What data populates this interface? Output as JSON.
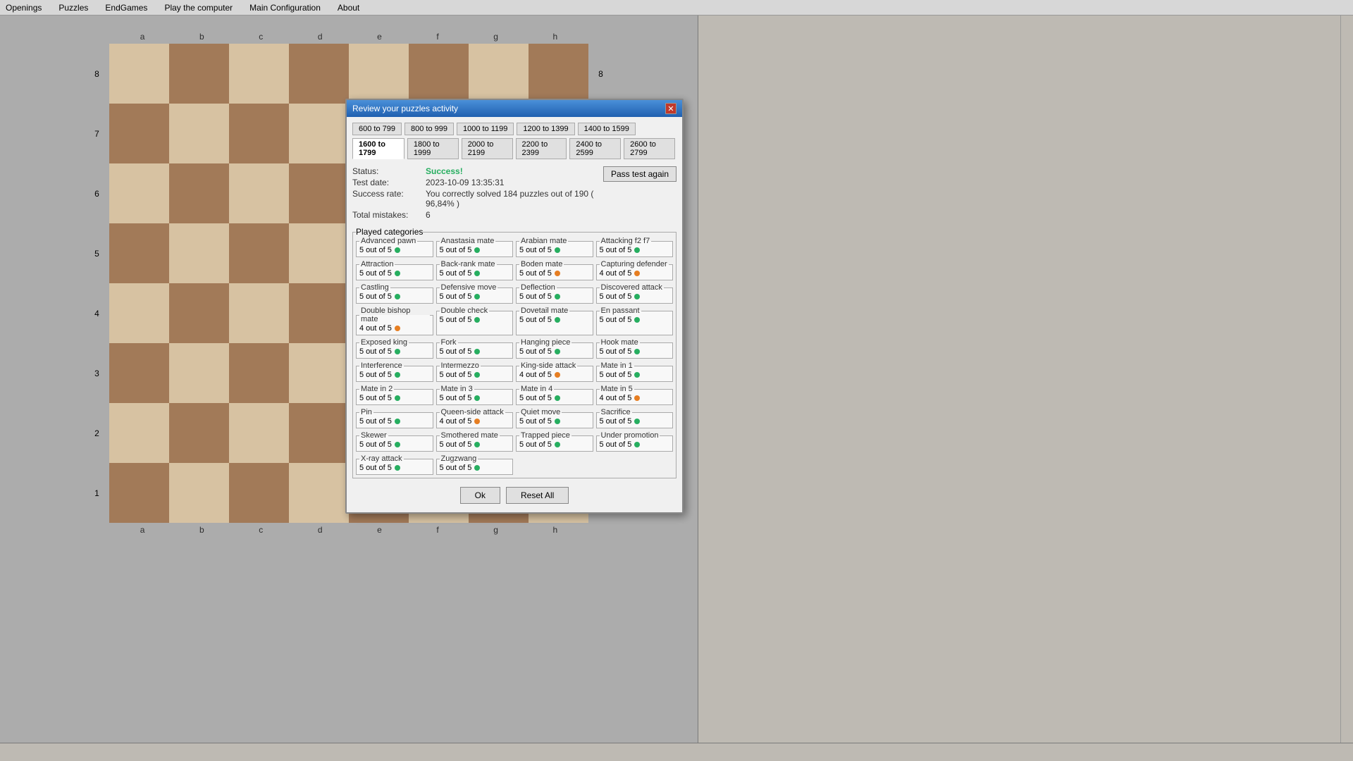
{
  "menu": {
    "items": [
      "Openings",
      "Puzzles",
      "EndGames",
      "Play the computer",
      "Main Configuration",
      "About"
    ]
  },
  "dialog": {
    "title": "Review your puzzles activity",
    "rating_tabs": [
      {
        "label": "600 to 799",
        "active": false
      },
      {
        "label": "800 to 999",
        "active": false
      },
      {
        "label": "1000 to 1199",
        "active": false
      },
      {
        "label": "1200 to 1399",
        "active": false
      },
      {
        "label": "1400 to 1599",
        "active": false
      },
      {
        "label": "1600 to 1799",
        "active": true
      },
      {
        "label": "1800 to 1999",
        "active": false
      },
      {
        "label": "2000 to 2199",
        "active": false
      },
      {
        "label": "2200 to 2399",
        "active": false
      },
      {
        "label": "2400 to 2599",
        "active": false
      },
      {
        "label": "2600 to 2799",
        "active": false
      }
    ],
    "status_label": "Status:",
    "status_value": "Success!",
    "test_date_label": "Test date:",
    "test_date_value": "2023-10-09 13:35:31",
    "success_rate_label": "Success rate:",
    "success_rate_value": "You correctly solved 184 puzzles out of 190 ( 96,84% )",
    "mistakes_label": "Total mistakes:",
    "mistakes_value": "6",
    "pass_test_btn": "Pass test again",
    "categories_label": "Played categories",
    "categories": [
      {
        "name": "Advanced pawn",
        "score": "5 out of 5",
        "dot": "green"
      },
      {
        "name": "Anastasia mate",
        "score": "5 out of 5",
        "dot": "green"
      },
      {
        "name": "Arabian mate",
        "score": "5 out of 5",
        "dot": "green"
      },
      {
        "name": "Attacking f2 f7",
        "score": "5 out of 5",
        "dot": "green"
      },
      {
        "name": "Attraction",
        "score": "5 out of 5",
        "dot": "green"
      },
      {
        "name": "Back-rank mate",
        "score": "5 out of 5",
        "dot": "green"
      },
      {
        "name": "Boden mate",
        "score": "5 out of 5",
        "dot": "orange"
      },
      {
        "name": "Capturing defender",
        "score": "4 out of 5",
        "dot": "orange"
      },
      {
        "name": "Castling",
        "score": "5 out of 5",
        "dot": "green"
      },
      {
        "name": "Defensive move",
        "score": "5 out of 5",
        "dot": "green"
      },
      {
        "name": "Deflection",
        "score": "5 out of 5",
        "dot": "green"
      },
      {
        "name": "Discovered attack",
        "score": "5 out of 5",
        "dot": "green"
      },
      {
        "name": "Double bishop mate",
        "score": "4 out of 5",
        "dot": "orange"
      },
      {
        "name": "Double check",
        "score": "5 out of 5",
        "dot": "green"
      },
      {
        "name": "Dovetail mate",
        "score": "5 out of 5",
        "dot": "green"
      },
      {
        "name": "En passant",
        "score": "5 out of 5",
        "dot": "green"
      },
      {
        "name": "Exposed king",
        "score": "5 out of 5",
        "dot": "green"
      },
      {
        "name": "Fork",
        "score": "5 out of 5",
        "dot": "green"
      },
      {
        "name": "Hanging piece",
        "score": "5 out of 5",
        "dot": "green"
      },
      {
        "name": "Hook mate",
        "score": "5 out of 5",
        "dot": "green"
      },
      {
        "name": "Interference",
        "score": "5 out of 5",
        "dot": "green"
      },
      {
        "name": "Intermezzo",
        "score": "5 out of 5",
        "dot": "green"
      },
      {
        "name": "King-side attack",
        "score": "4 out of 5",
        "dot": "orange"
      },
      {
        "name": "Mate in 1",
        "score": "5 out of 5",
        "dot": "green"
      },
      {
        "name": "Mate in 2",
        "score": "5 out of 5",
        "dot": "green"
      },
      {
        "name": "Mate in 3",
        "score": "5 out of 5",
        "dot": "green"
      },
      {
        "name": "Mate in 4",
        "score": "5 out of 5",
        "dot": "green"
      },
      {
        "name": "Mate in 5",
        "score": "4 out of 5",
        "dot": "orange"
      },
      {
        "name": "Pin",
        "score": "5 out of 5",
        "dot": "green"
      },
      {
        "name": "Queen-side attack",
        "score": "4 out of 5",
        "dot": "orange"
      },
      {
        "name": "Quiet move",
        "score": "5 out of 5",
        "dot": "green"
      },
      {
        "name": "Sacrifice",
        "score": "5 out of 5",
        "dot": "green"
      },
      {
        "name": "Skewer",
        "score": "5 out of 5",
        "dot": "green"
      },
      {
        "name": "Smothered mate",
        "score": "5 out of 5",
        "dot": "green"
      },
      {
        "name": "Trapped piece",
        "score": "5 out of 5",
        "dot": "green"
      },
      {
        "name": "Under promotion",
        "score": "5 out of 5",
        "dot": "green"
      },
      {
        "name": "X-ray attack",
        "score": "5 out of 5",
        "dot": "green"
      },
      {
        "name": "Zugzwang",
        "score": "5 out of 5",
        "dot": "green"
      }
    ],
    "ok_btn": "Ok",
    "reset_btn": "Reset All"
  },
  "board": {
    "col_labels": [
      "a",
      "b",
      "c",
      "d",
      "e",
      "f",
      "g",
      "h"
    ],
    "row_labels": [
      "8",
      "7",
      "6",
      "5",
      "4",
      "3",
      "2",
      "1"
    ]
  }
}
